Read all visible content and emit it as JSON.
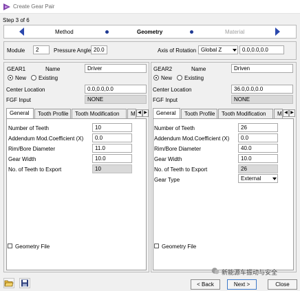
{
  "window": {
    "title": "Create Gear Pair"
  },
  "wizard": {
    "step_text": "Step 3 of 6",
    "steps": [
      "Method",
      "Geometry",
      "Material"
    ],
    "active_step": "Geometry"
  },
  "global": {
    "module_label": "Module",
    "module_value": "2",
    "pressure_angle_label": "Pressure Angle",
    "pressure_angle_value": "20.0",
    "axis_label": "Axis of Rotation",
    "axis_value": "Global Z",
    "axis_vector": "0.0,0.0,0.0"
  },
  "gear1": {
    "header": "GEAR1",
    "name_label": "Name",
    "name_value": "Driver",
    "new_label": "New",
    "existing_label": "Existing",
    "center_label": "Center Location",
    "center_value": "0.0,0.0,0.0",
    "fgf_label": "FGF Input",
    "fgf_value": "NONE",
    "tabs": [
      "General",
      "Tooth Profile",
      "Tooth Modification",
      "Me"
    ],
    "fields": [
      {
        "label": "Number of Teeth",
        "value": "10",
        "readonly": false
      },
      {
        "label": "Addendum Mod.Coefficient (X)",
        "value": "0.0",
        "readonly": false
      },
      {
        "label": "Rim/Bore Diameter",
        "value": "11.0",
        "readonly": false
      },
      {
        "label": "Gear Width",
        "value": "10.0",
        "readonly": false
      },
      {
        "label": "No. of Teeth to Export",
        "value": "10",
        "readonly": true
      }
    ],
    "geometry_file_label": "Geometry File"
  },
  "gear2": {
    "header": "GEAR2",
    "name_label": "Name",
    "name_value": "Driven",
    "new_label": "New",
    "existing_label": "Existing",
    "center_label": "Center Location",
    "center_value": "36.0,0.0,0.0",
    "fgf_label": "FGF Input",
    "fgf_value": "NONE",
    "tabs": [
      "General",
      "Tooth Profile",
      "Tooth Modification",
      "Me"
    ],
    "fields": [
      {
        "label": "Number of Teeth",
        "value": "26",
        "readonly": false
      },
      {
        "label": "Addendum Mod.Coefficient (X)",
        "value": "0.0",
        "readonly": false
      },
      {
        "label": "Rim/Bore Diameter",
        "value": "40.0",
        "readonly": false
      },
      {
        "label": "Gear Width",
        "value": "10.0",
        "readonly": false
      },
      {
        "label": "No. of Teeth to Export",
        "value": "26",
        "readonly": true
      }
    ],
    "gear_type_label": "Gear Type",
    "gear_type_value": "External",
    "geometry_file_label": "Geometry File"
  },
  "footer": {
    "back_label": "< Back",
    "next_label": "Next >",
    "close_label": "Close"
  },
  "watermark": {
    "text": "新能源车振动与安全"
  },
  "icons": {
    "app": "gear-pair-app-icon",
    "open": "open-folder-icon",
    "save": "save-disk-icon",
    "prev": "previous-step-icon",
    "next": "next-step-icon"
  },
  "colors": {
    "accent": "#2a47ad",
    "readonly_field": "#d9d9d9",
    "panel_bg": "#f0f0f0"
  }
}
